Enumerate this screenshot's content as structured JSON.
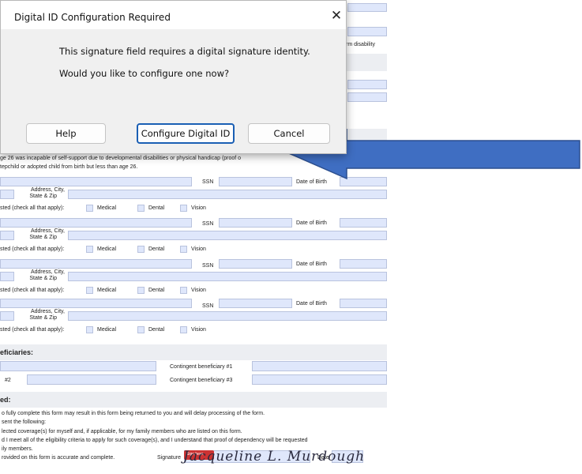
{
  "dialog": {
    "title": "Digital ID Configuration Required",
    "close_glyph": "✕",
    "message_line1": "This signature field requires a digital signature identity.",
    "message_line2": "Would you like to configure one now?",
    "help_label": "Help",
    "configure_label": "Configure Digital ID",
    "cancel_label": "Cancel"
  },
  "annotation": {
    "arrow_color": "#3f6ec2",
    "arrow_border": "#2c4f8f",
    "arrow_icon": "left-arrow-icon"
  },
  "form": {
    "disability_text": "rm disability",
    "incapable_line1": "ge 26 was incapable of self-support due to developmental disabilities or physical handicap (proof o",
    "incapable_line2": "tepchild or adopted child from birth but less than age 26.",
    "dependents": [
      {
        "ssn": "SSN",
        "dob": "Date of Birth",
        "address": "Address, City,",
        "state": "State & Zip",
        "coverage": "sted (check all that apply):",
        "medical": "Medical",
        "dental": "Dental",
        "vision": "Vision"
      },
      {
        "ssn": "SSN",
        "dob": "Date of Birth",
        "address": "Address, City,",
        "state": "State & Zip",
        "coverage": "sted (check all that apply):",
        "medical": "Medical",
        "dental": "Dental",
        "vision": "Vision"
      },
      {
        "ssn": "SSN",
        "dob": "Date of Birth",
        "address": "Address, City,",
        "state": "State & Zip",
        "coverage": "sted (check all that apply):",
        "medical": "Medical",
        "dental": "Dental",
        "vision": "Vision"
      },
      {
        "ssn": "SSN",
        "dob": "Date of Birth",
        "address": "Address, City,",
        "state": "State & Zip",
        "coverage": "sted (check all that apply):",
        "medical": "Medical",
        "dental": "Dental",
        "vision": "Vision"
      }
    ],
    "beneficiaries_heading": "eficiaries:",
    "contingent1": "Contingent beneficiary #1",
    "contingent3": "Contingent beneficiary #3",
    "primary2": "#2",
    "required_heading": "ed:",
    "req_line1": "o fully complete this form may result in this form being returned to you and will delay processing of the form.",
    "req_line2": "sent the following:",
    "req_line3": "lected coverage(s) for myself and, if applicable, for my family members who are listed on this form.",
    "req_line4": "d I meet all of the eligibility criteria to apply for such coverage(s), and I understand that proof of dependency will be requested",
    "req_line5": "ily members.",
    "req_line6": "rovided on this form is accurate and complete.",
    "signature_label": "Signature",
    "date_label": "Date",
    "sign_here_tag": "Sign here",
    "signature_name": "Jacqueline L. Murdough"
  }
}
